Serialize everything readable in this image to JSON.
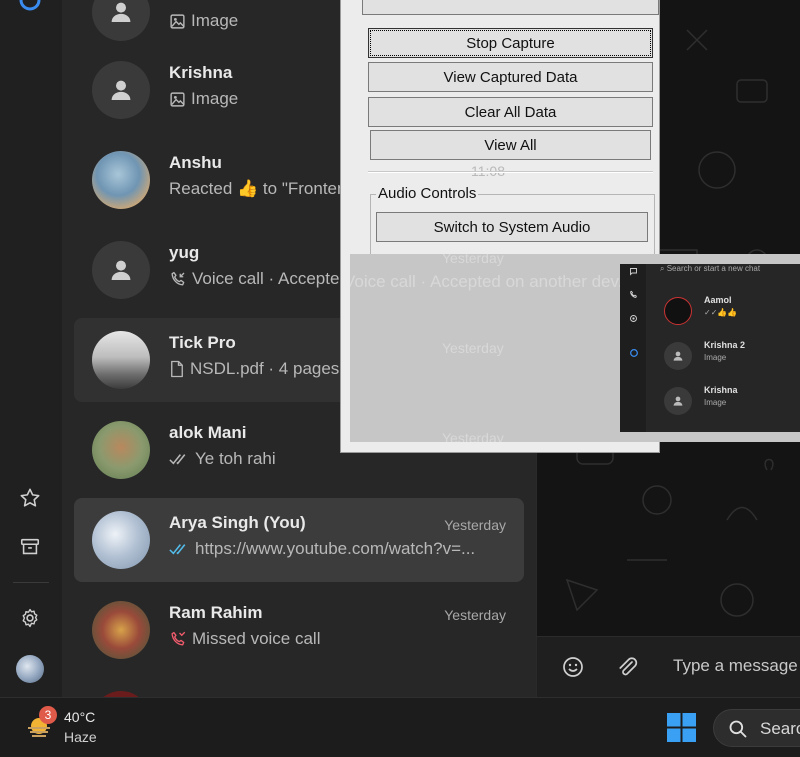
{
  "chats": [
    {
      "name": "",
      "preview": "Image",
      "time": "",
      "preview_icon": "image-icon"
    },
    {
      "name": "Krishna",
      "preview": "Image",
      "time": "",
      "preview_icon": "image-icon"
    },
    {
      "name": "Anshu",
      "preview": "Reacted 👍 to \"Frontend\"",
      "time": "",
      "preview_icon": ""
    },
    {
      "name": "yug",
      "preview": "Voice call · Accepted on another dev...",
      "time": "Yesterday",
      "preview_icon": "voice-call-incoming-icon"
    },
    {
      "name": "Tick Pro",
      "preview": "NSDL.pdf · 4 pages",
      "time": "Yesterday",
      "preview_icon": "document-icon"
    },
    {
      "name": "alok Mani",
      "preview": "Ye toh rahi",
      "time": "Yesterday",
      "preview_icon": "double-tick-icon"
    },
    {
      "name": "Arya Singh (You)",
      "preview": "https://www.youtube.com/watch?v=...",
      "time": "Yesterday",
      "preview_icon": "double-tick-blue-icon"
    },
    {
      "name": "Ram Rahim",
      "preview": "Missed voice call",
      "time": "Yesterday",
      "preview_icon": "missed-call-icon"
    }
  ],
  "composer": {
    "placeholder": "Type a message"
  },
  "capture_panel": {
    "buttons": [
      "Stop Capture",
      "View Captured Data",
      "Clear All Data",
      "View All"
    ],
    "audio_group_label": "Audio Controls",
    "audio_buttons": [
      "Switch to System Audio"
    ],
    "ghost_time": "11:08"
  },
  "mini_preview": {
    "search_placeholder": "Search or start a new chat",
    "rows": [
      {
        "name": "Aamol",
        "preview": "✓✓👍👍"
      },
      {
        "name": "Krishna 2",
        "preview": "Image"
      },
      {
        "name": "Krishna",
        "preview": "Image"
      }
    ]
  },
  "taskbar": {
    "weather_badge": "3",
    "temperature": "40°C",
    "condition": "Haze",
    "search_label": "Search"
  },
  "colors": {
    "accent_blue": "#53bdeb",
    "missed_call": "#f15c6d",
    "windows_blue": "#3aa0f3"
  }
}
